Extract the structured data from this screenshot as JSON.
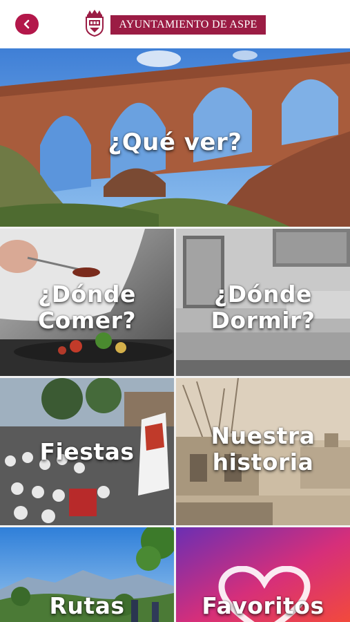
{
  "header": {
    "back_button": "back",
    "brand_name": "AYUNTAMIENTO DE ASPE",
    "logo": "aspe-crest-icon"
  },
  "tiles": {
    "que_ver": "¿Qué ver?",
    "donde_comer_line1": "¿Dónde",
    "donde_comer_line2": "Comer?",
    "donde_dormir_line1": "¿Dónde",
    "donde_dormir_line2": "Dormir?",
    "fiestas": "Fiestas",
    "historia_line1": "Nuestra",
    "historia_line2": "historia",
    "rutas": "Rutas",
    "favoritos": "Favoritos"
  },
  "colors": {
    "brand": "#9b1c44",
    "back_button": "#b3174a",
    "favoritos_gradient": [
      "#6b2fb3",
      "#d62f7a",
      "#f24a3c"
    ]
  }
}
